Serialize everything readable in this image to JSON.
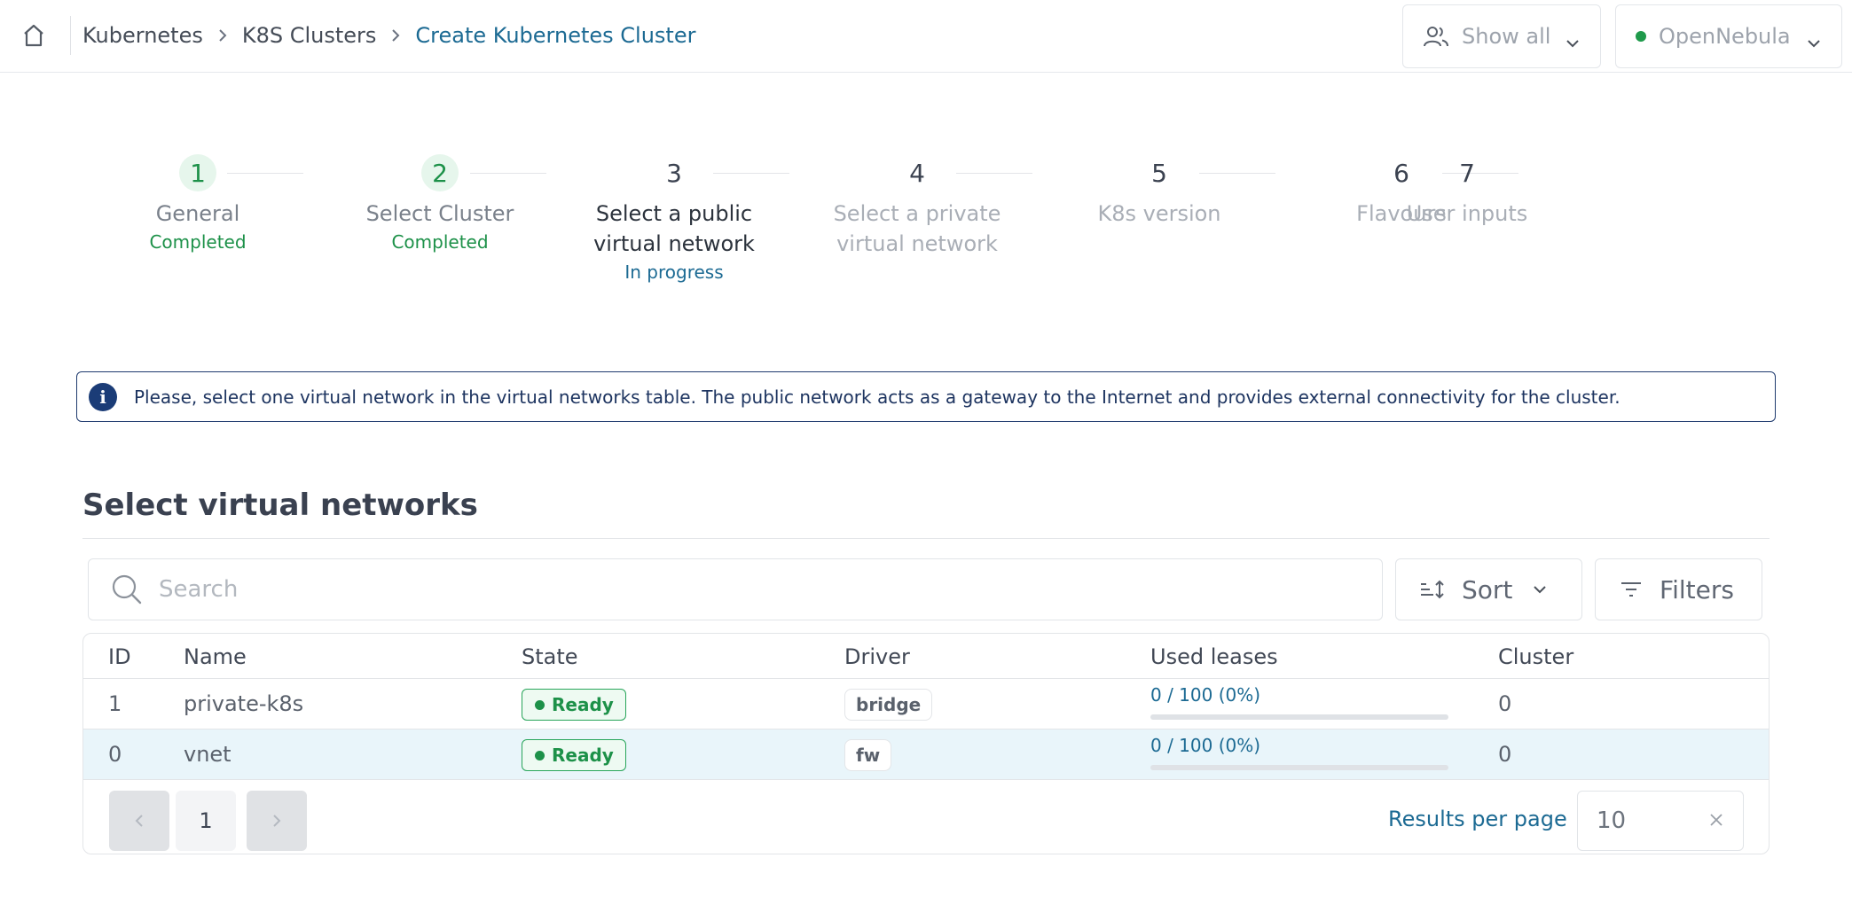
{
  "breadcrumb": {
    "items": [
      "Kubernetes",
      "K8S Clusters"
    ],
    "current": "Create Kubernetes Cluster"
  },
  "header": {
    "group_filter": "Show all",
    "zone": {
      "label": "OpenNebula",
      "status_color": "#1f9a4b"
    }
  },
  "stepper": {
    "steps": [
      {
        "number": "1",
        "title": "General",
        "status": "Completed"
      },
      {
        "number": "2",
        "title": "Select Cluster",
        "status": "Completed"
      },
      {
        "number": "3",
        "title": "Select a public virtual network",
        "status": "In progress"
      },
      {
        "number": "4",
        "title": "Select a private virtual network",
        "status": ""
      },
      {
        "number": "5",
        "title": "K8s version",
        "status": ""
      },
      {
        "number": "6",
        "title": "Flavours",
        "status": ""
      },
      {
        "number": "7",
        "title": "User inputs",
        "status": ""
      }
    ]
  },
  "info": {
    "icon": "info-icon",
    "message": "Please, select one virtual network in the virtual networks table. The public network acts as a gateway to the Internet and provides external connectivity for the cluster."
  },
  "section": {
    "title": "Select virtual networks"
  },
  "toolbar": {
    "search_placeholder": "Search",
    "sort_label": "Sort",
    "filters_label": "Filters"
  },
  "table": {
    "columns": [
      "ID",
      "Name",
      "State",
      "Driver",
      "Used leases",
      "Cluster"
    ],
    "rows": [
      {
        "id": "1",
        "name": "private-k8s",
        "state": "Ready",
        "driver": "bridge",
        "leases": "0 / 100 (0%)",
        "leases_fraction": 0,
        "cluster": "0",
        "selected": false
      },
      {
        "id": "0",
        "name": "vnet",
        "state": "Ready",
        "driver": "fw",
        "leases": "0 / 100 (0%)",
        "leases_fraction": 0,
        "cluster": "0",
        "selected": true
      }
    ]
  },
  "pagination": {
    "current_page": "1",
    "results_per_page_label": "Results per page",
    "results_per_page": "10"
  },
  "colors": {
    "accent": "#1c6a93",
    "success": "#1d9149",
    "info_border": "#1f3a6e",
    "selected_row": "#e9f5fa"
  }
}
